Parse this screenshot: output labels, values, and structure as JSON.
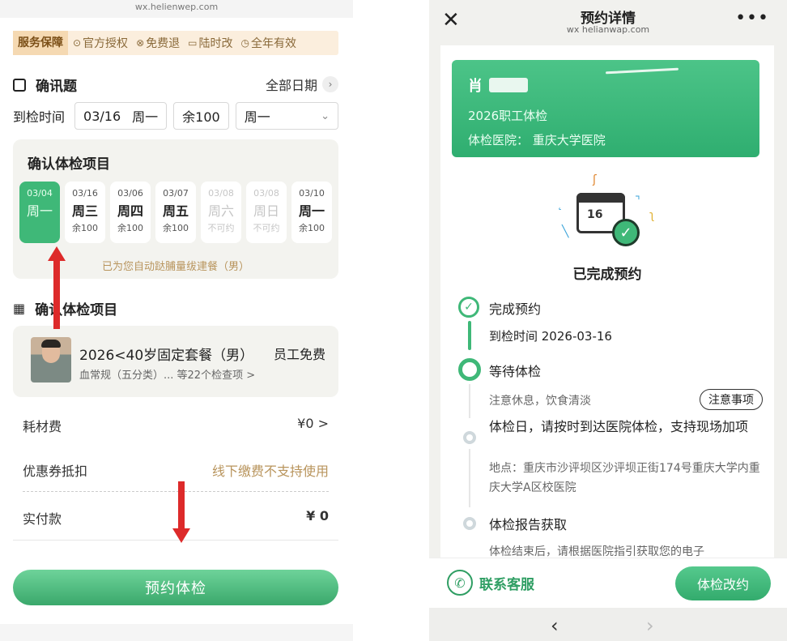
{
  "left": {
    "url": "wx.helienwep.com",
    "guarantee": {
      "title": "服务保障",
      "items": [
        {
          "icon": "check-circle-icon",
          "glyph": "⊙",
          "label": "官方授权"
        },
        {
          "icon": "free-icon",
          "glyph": "⊗",
          "label": "免费退"
        },
        {
          "icon": "calendar-icon",
          "glyph": "▭",
          "label": "陆时改"
        },
        {
          "icon": "clock-icon",
          "glyph": "◷",
          "label": "全年有效"
        }
      ]
    },
    "confirm_header": "确讯题",
    "all_dates": "全部日期",
    "time_row": {
      "label": "到检时间",
      "date": "03/16",
      "weekday": "周一",
      "remain": "余100",
      "select": "周一"
    },
    "date_card": {
      "title": "确认体检项目",
      "days": [
        {
          "date": "03/04",
          "weekday": "周一",
          "status": "",
          "state": "active"
        },
        {
          "date": "03/16",
          "weekday": "周三",
          "status": "余100",
          "state": "normal"
        },
        {
          "date": "03/06",
          "weekday": "周四",
          "status": "余100",
          "state": "normal"
        },
        {
          "date": "03/07",
          "weekday": "周五",
          "status": "余100",
          "state": "normal"
        },
        {
          "date": "03/08",
          "weekday": "周六",
          "status": "不可约",
          "state": "disabled"
        },
        {
          "date": "03/08",
          "weekday": "周日",
          "status": "不可约",
          "state": "disabled"
        },
        {
          "date": "03/10",
          "weekday": "周一",
          "status": "余100",
          "state": "normal"
        }
      ],
      "note": "已为您自动跶脯量绂䢖餐（男）"
    },
    "package_header": "确认体检项目",
    "package": {
      "name": "2026<40岁固定套餐（男）",
      "tag": "员工免费",
      "detail": "血常规（五分类）... 等22个检查项 >"
    },
    "fees": {
      "material_label": "耗材费",
      "material_value": "¥0 >",
      "coupon_label": "优惠券抵扣",
      "coupon_value": "线下缴费不支持使用",
      "paid_label": "实付款",
      "paid_value": "¥ 0"
    },
    "book_button": "预约体检",
    "colors": {
      "accent": "#3fb878",
      "arrow": "#dd2a2a",
      "gold": "#b8945c"
    }
  },
  "right": {
    "header": {
      "title": "预约详情",
      "url": "wx helianwap.com",
      "close_icon": "close-icon",
      "more_icon": "more-icon"
    },
    "card": {
      "name": "肖",
      "plan": "2026职工体检",
      "hospital": "体检医院：  重庆大学医院"
    },
    "illustration": {
      "calendar_number": "16"
    },
    "status_text": "已完成预约",
    "timeline": [
      {
        "title": "完成预约",
        "sub": "到检时间 2026-03-16"
      },
      {
        "title": "等待体检",
        "sub": "注意休息，饮食清淡",
        "button": "注意事项"
      },
      {
        "title": "体检日，请按时到达医院体检，支持现场加项",
        "sub": "地点：重庆市沙评坝区沙评坝正街174号重庆大学内重庆大学A区校医院"
      },
      {
        "title": "体检报告获取",
        "sub": "体检结束后，请根据医院指引获取您的电子"
      }
    ],
    "bottom": {
      "service_label": "联系客服",
      "change_button": "体检改约"
    },
    "nav": {
      "back": "‹",
      "forward": "›"
    }
  }
}
